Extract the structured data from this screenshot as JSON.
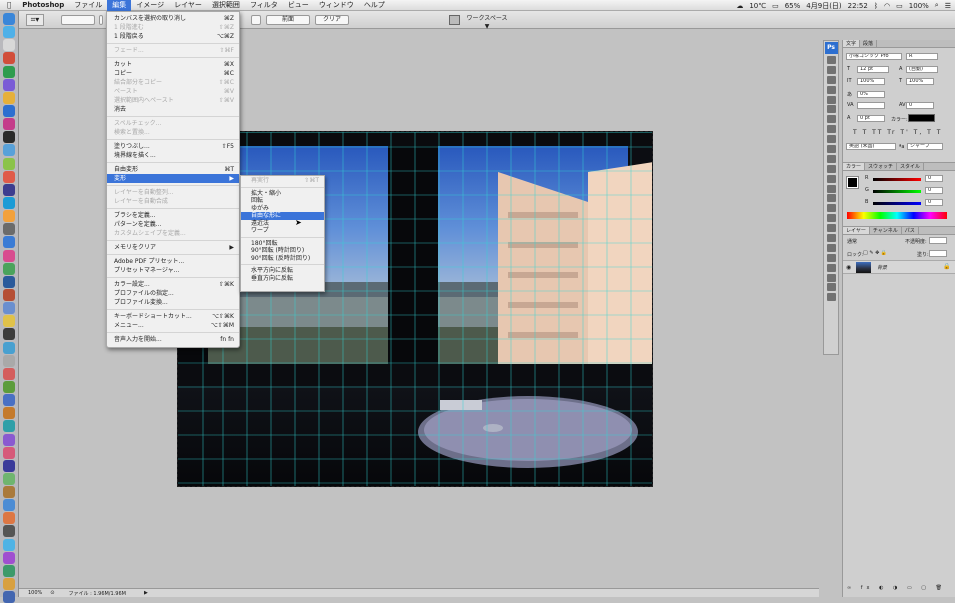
{
  "menubar": {
    "items": [
      "Photoshop",
      "ファイル",
      "編集",
      "イメージ",
      "レイヤー",
      "選択範囲",
      "フィルタ",
      "ビュー",
      "ウィンドウ",
      "ヘルプ"
    ],
    "status": {
      "weather": "10℃",
      "battery": "65%",
      "date": "4月9日(日)",
      "time": "22:52",
      "battery2": "100%"
    }
  },
  "optionsbar": {
    "front_image_label": "前面",
    "clear_label": "クリア",
    "workspace_label": "ワークスペース ▼"
  },
  "edit_menu": {
    "items": [
      {
        "label": "カンバスを選択の取り消し",
        "shortcut": "⌘Z",
        "disabled": false
      },
      {
        "label": "1 段階進む",
        "shortcut": "⇧⌘Z",
        "disabled": true
      },
      {
        "label": "1 段階戻る",
        "shortcut": "⌥⌘Z",
        "disabled": false
      },
      {
        "label": "フェード...",
        "shortcut": "⇧⌘F",
        "disabled": true
      },
      {
        "label": "カット",
        "shortcut": "⌘X",
        "disabled": false
      },
      {
        "label": "コピー",
        "shortcut": "⌘C",
        "disabled": false
      },
      {
        "label": "結合部分をコピー",
        "shortcut": "⇧⌘C",
        "disabled": true
      },
      {
        "label": "ペースト",
        "shortcut": "⌘V",
        "disabled": true
      },
      {
        "label": "選択範囲内へペースト",
        "shortcut": "⇧⌘V",
        "disabled": true
      },
      {
        "label": "消去",
        "shortcut": "",
        "disabled": false
      },
      {
        "label": "スペルチェック...",
        "shortcut": "",
        "disabled": true
      },
      {
        "label": "検索と置換...",
        "shortcut": "",
        "disabled": true
      },
      {
        "label": "塗りつぶし...",
        "shortcut": "⇧F5",
        "disabled": false
      },
      {
        "label": "境界線を描く...",
        "shortcut": "",
        "disabled": false
      },
      {
        "label": "自由変形",
        "shortcut": "⌘T",
        "disabled": false
      },
      {
        "label": "変形",
        "shortcut": "▶",
        "disabled": false,
        "highlight": true
      },
      {
        "label": "レイヤーを自動整列...",
        "shortcut": "",
        "disabled": true
      },
      {
        "label": "レイヤーを自動合成",
        "shortcut": "",
        "disabled": true
      },
      {
        "label": "ブラシを定義...",
        "shortcut": "",
        "disabled": false
      },
      {
        "label": "パターンを定義...",
        "shortcut": "",
        "disabled": false
      },
      {
        "label": "カスタムシェイプを定義...",
        "shortcut": "",
        "disabled": true
      },
      {
        "label": "メモリをクリア",
        "shortcut": "▶",
        "disabled": false
      },
      {
        "label": "Adobe PDF プリセット...",
        "shortcut": "",
        "disabled": false
      },
      {
        "label": "プリセットマネージャ...",
        "shortcut": "",
        "disabled": false
      },
      {
        "label": "カラー設定...",
        "shortcut": "⇧⌘K",
        "disabled": false
      },
      {
        "label": "プロファイルの指定...",
        "shortcut": "",
        "disabled": false
      },
      {
        "label": "プロファイル変換...",
        "shortcut": "",
        "disabled": false
      },
      {
        "label": "キーボードショートカット...",
        "shortcut": "⌥⇧⌘K",
        "disabled": false
      },
      {
        "label": "メニュー...",
        "shortcut": "⌥⇧⌘M",
        "disabled": false
      },
      {
        "label": "音声入力を開始...",
        "shortcut": "fn fn",
        "disabled": false
      }
    ]
  },
  "transform_submenu": {
    "items": [
      {
        "label": "再実行",
        "shortcut": "⇧⌘T",
        "disabled": true
      },
      {
        "label": "拡大・縮小",
        "disabled": false
      },
      {
        "label": "回転",
        "disabled": false
      },
      {
        "label": "ゆがみ",
        "disabled": false
      },
      {
        "label": "自由な形に",
        "disabled": false,
        "highlight": true
      },
      {
        "label": "遠近法",
        "disabled": false
      },
      {
        "label": "ワープ",
        "disabled": false
      },
      {
        "label": "180°回転",
        "disabled": false
      },
      {
        "label": "90°回転 (時計回り)",
        "disabled": false
      },
      {
        "label": "90°回転 (反時計回り)",
        "disabled": false
      },
      {
        "label": "水平方向に反転",
        "disabled": false
      },
      {
        "label": "垂直方向に反転",
        "disabled": false
      }
    ]
  },
  "character_panel": {
    "tabs": [
      "文字",
      "段落"
    ],
    "font_family": "小塚ゴシック Pro",
    "font_style": "R",
    "font_size": "12 pt",
    "leading": "(自動)",
    "vertical_scale": "100%",
    "horizontal_scale": "100%",
    "tsume": "0%",
    "tracking": "0",
    "baseline": "0 pt",
    "color_label": "カラー:",
    "language": "英語 (米国)",
    "antialias": "シャープ"
  },
  "color_panel": {
    "tabs": [
      "カラー",
      "スウォッチ",
      "スタイル"
    ],
    "r": "0",
    "g": "0",
    "b": "0"
  },
  "layers_panel": {
    "tabs": [
      "レイヤー",
      "チャンネル",
      "パス"
    ],
    "blend_mode": "通常",
    "opacity_label": "不透明度:",
    "lock_label": "ロック:",
    "fill_label": "塗り:",
    "layer_name": "背景"
  },
  "statusbar": {
    "zoom": "100%",
    "file_info": "ファイル : 1.96M/1.96M"
  },
  "colors": {
    "accent": "#3b74d9",
    "guide": "#33d6d6"
  }
}
